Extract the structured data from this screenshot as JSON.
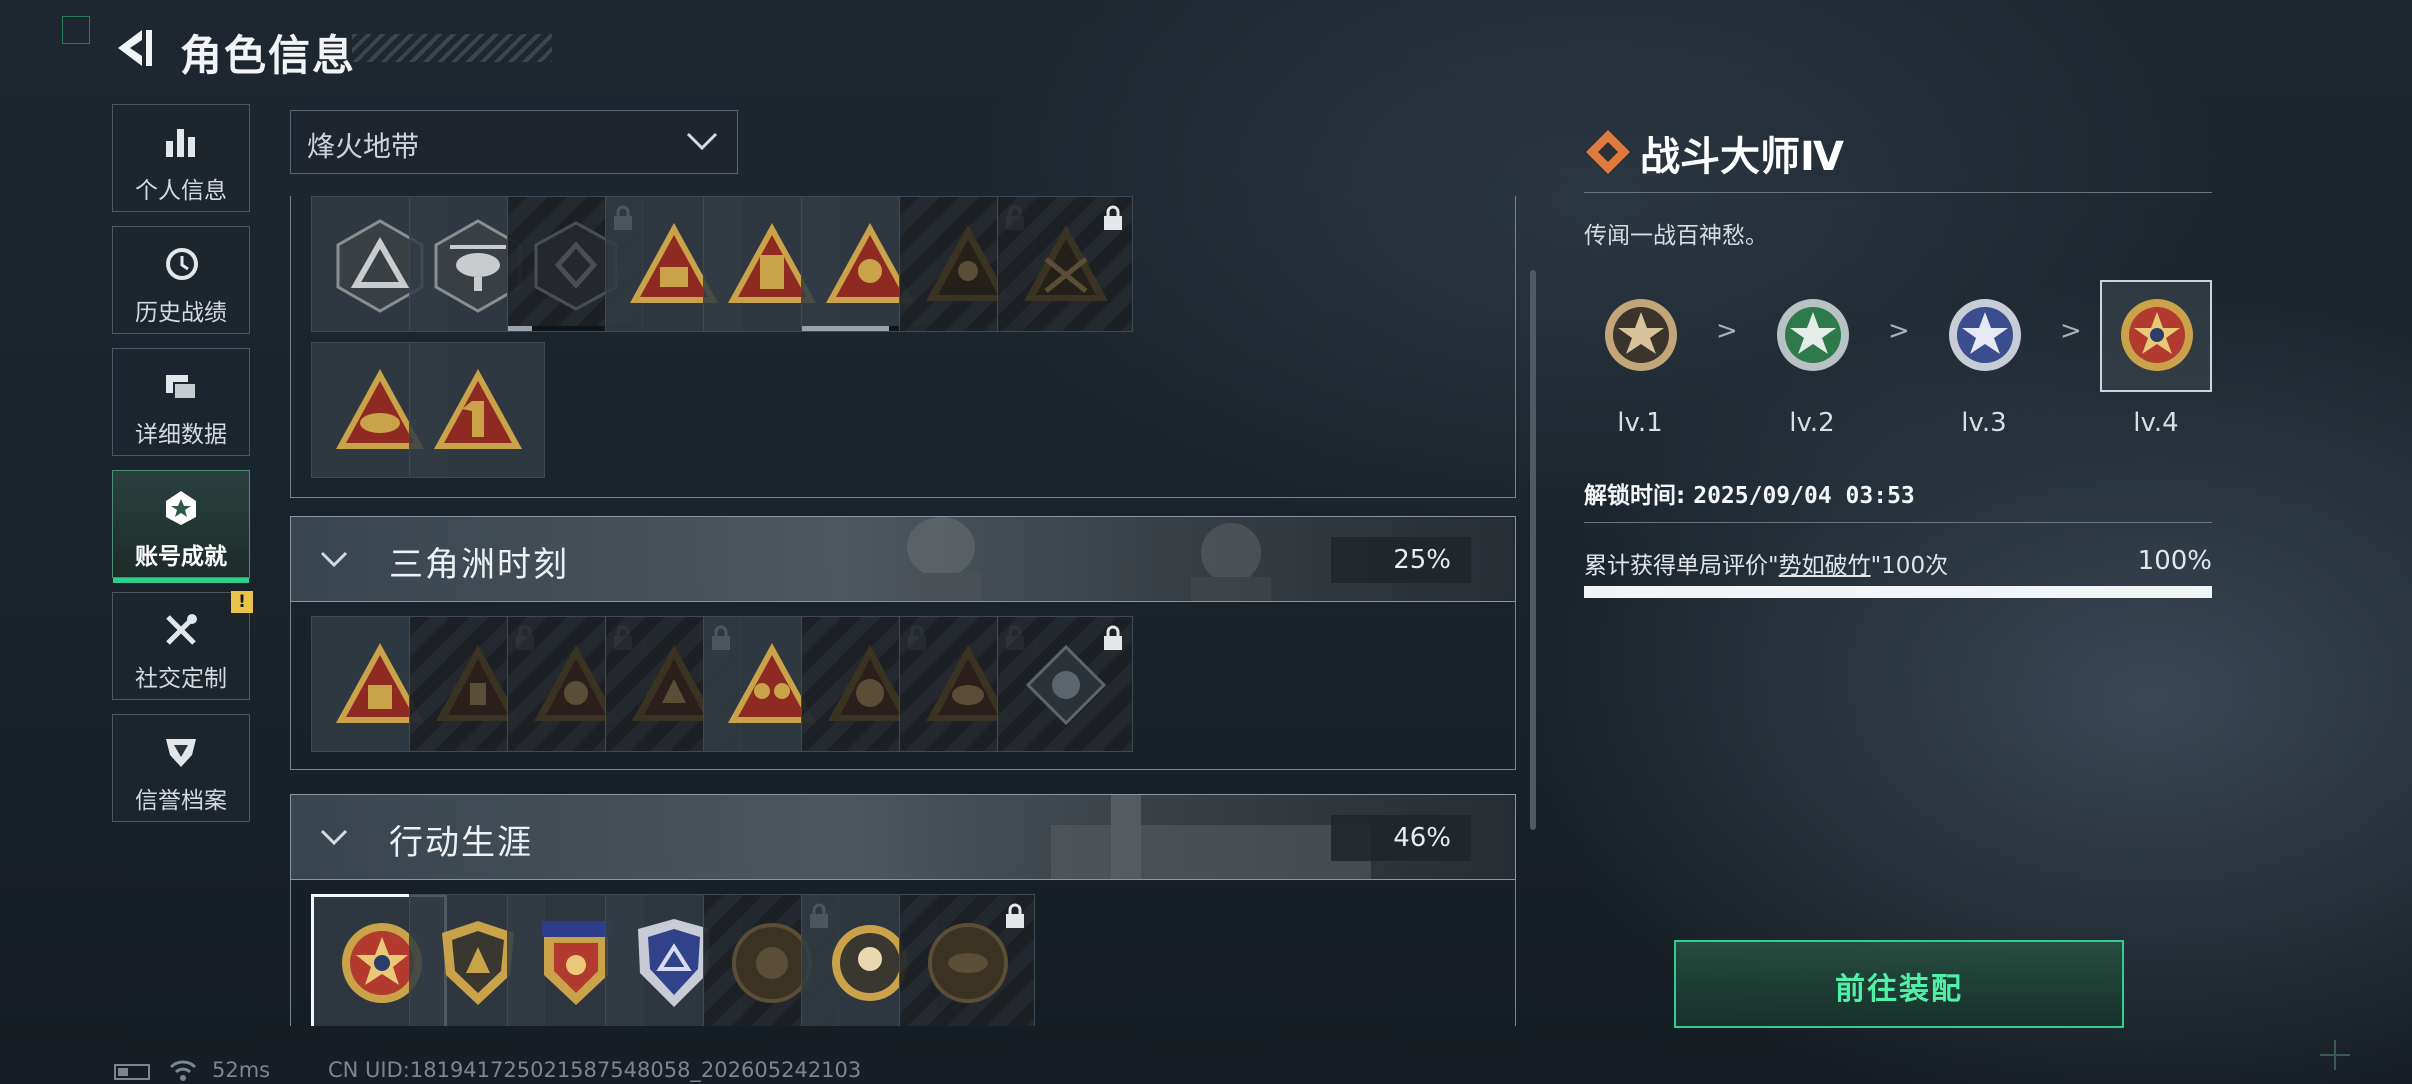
{
  "header": {
    "title": "角色信息"
  },
  "sidebar": {
    "items": [
      {
        "label": "个人信息",
        "icon": "bar-chart-icon"
      },
      {
        "label": "历史战绩",
        "icon": "history-clock-icon"
      },
      {
        "label": "详细数据",
        "icon": "data-cards-icon"
      },
      {
        "label": "账号成就",
        "icon": "achievement-badge-icon",
        "active": true
      },
      {
        "label": "社交定制",
        "icon": "tools-icon",
        "alert": "!"
      },
      {
        "label": "信誉档案",
        "icon": "credit-shield-icon"
      }
    ]
  },
  "mode_select": {
    "value": "烽火地带"
  },
  "groups": [
    {
      "name": "",
      "badges": 10
    },
    {
      "name": "三角洲时刻",
      "percent": "25%"
    },
    {
      "name": "行动生涯",
      "percent": "46%"
    }
  ],
  "detail": {
    "title": "战斗大师Ⅳ",
    "description": "传闻一战百神愁。",
    "levels": [
      "lv.1",
      "lv.2",
      "lv.3",
      "lv.4"
    ],
    "level_separator": ">",
    "unlock_label": "解锁时间:",
    "unlock_time": "2025/09/04 03:53",
    "requirement_prefix": "累计获得单局评价\"",
    "requirement_highlight": "势如破竹",
    "requirement_suffix": "\"100次",
    "requirement_percent": "100%",
    "requirement_progress": 1.0
  },
  "equip_button": {
    "label": "前往装配"
  },
  "status": {
    "ping": "52ms",
    "uid": "CN UID:18194172502158754805​8_202605242103"
  },
  "colors": {
    "accent_green": "#2fd08f",
    "badge_gold": "#c9a24a",
    "badge_red": "#8e2a22"
  }
}
